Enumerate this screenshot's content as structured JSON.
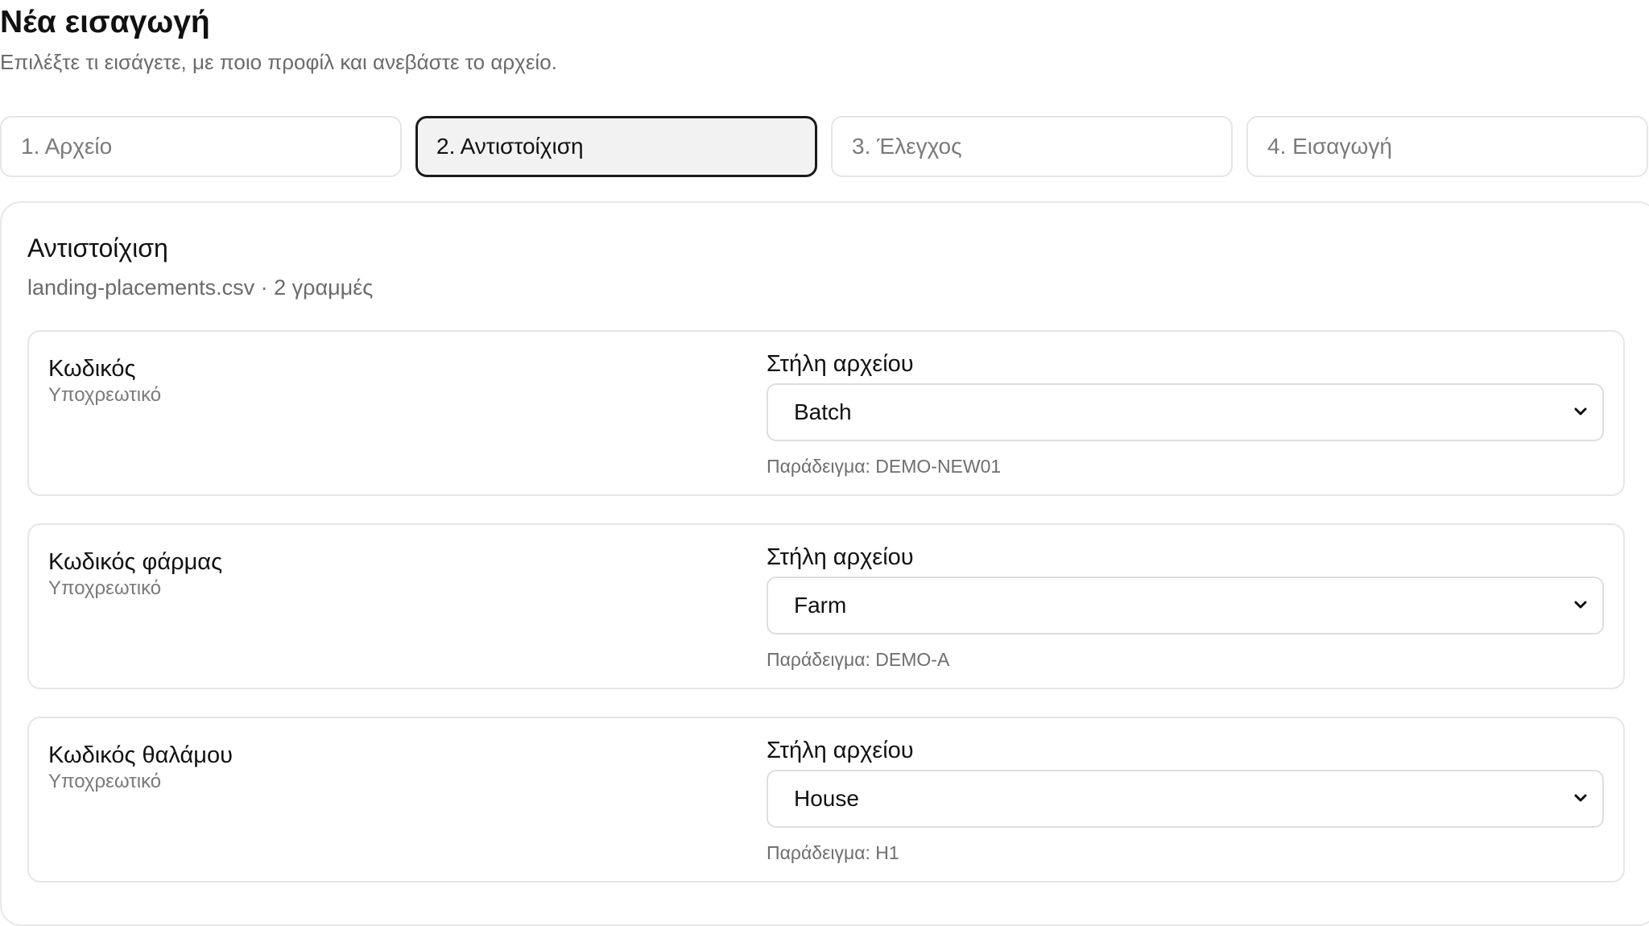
{
  "header": {
    "title": "Νέα εισαγωγή",
    "subtitle": "Επιλέξτε τι εισάγετε, με ποιο προφίλ και ανεβάστε το αρχείο."
  },
  "steps": [
    {
      "label": "1. Αρχείο",
      "active": false
    },
    {
      "label": "2. Αντιστοίχιση",
      "active": true
    },
    {
      "label": "3. Έλεγχος",
      "active": false
    },
    {
      "label": "4. Εισαγωγή",
      "active": false
    }
  ],
  "mapping": {
    "title": "Αντιστοίχιση",
    "file_info": "landing-placements.csv · 2 γραμμές",
    "column_label": "Στήλη αρχείου",
    "rows": [
      {
        "field": "Κωδικός",
        "requirement": "Υποχρεωτικό",
        "selected_column": "Batch",
        "example": "Παράδειγμα: DEMO-NEW01"
      },
      {
        "field": "Κωδικός φάρμας",
        "requirement": "Υποχρεωτικό",
        "selected_column": "Farm",
        "example": "Παράδειγμα: DEMO-A"
      },
      {
        "field": "Κωδικός θαλάμου",
        "requirement": "Υποχρεωτικό",
        "selected_column": "House",
        "example": "Παράδειγμα: H1"
      }
    ]
  },
  "icons": {
    "select_arrow": "chevron-down-icon"
  },
  "colors": {
    "active_step_border": "#1b1b1b",
    "active_step_bg": "#f2f2f2",
    "muted_text": "#6b6b6b",
    "border": "#e6e6e6"
  }
}
